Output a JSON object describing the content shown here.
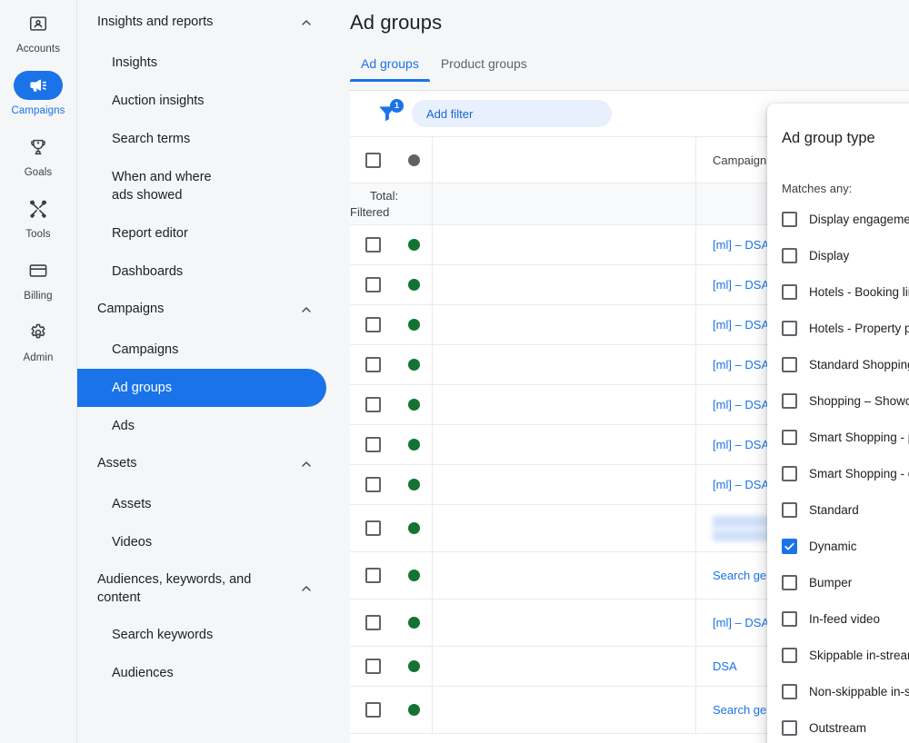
{
  "rail": {
    "items": [
      {
        "label": "Accounts",
        "icon": "accounts-icon",
        "active": false
      },
      {
        "label": "Campaigns",
        "icon": "campaigns-megaphone-icon",
        "active": true
      },
      {
        "label": "Goals",
        "icon": "goals-trophy-icon",
        "active": false
      },
      {
        "label": "Tools",
        "icon": "tools-wrench-icon",
        "active": false
      },
      {
        "label": "Billing",
        "icon": "billing-card-icon",
        "active": false
      },
      {
        "label": "Admin",
        "icon": "admin-gear-icon",
        "active": false
      }
    ]
  },
  "nav": {
    "groups": [
      {
        "title": "Insights and reports",
        "expanded": true,
        "items": [
          "Insights",
          "Auction insights",
          "Search terms",
          "When and where ads showed",
          "Report editor",
          "Dashboards"
        ]
      },
      {
        "title": "Campaigns",
        "expanded": true,
        "items": [
          "Campaigns",
          "Ad groups",
          "Ads"
        ]
      },
      {
        "title": "Assets",
        "expanded": true,
        "items": [
          "Assets",
          "Videos"
        ]
      },
      {
        "title": "Audiences, keywords, and content",
        "expanded": true,
        "items": [
          "Search keywords",
          "Audiences"
        ]
      }
    ],
    "selected": "Ad groups"
  },
  "header": {
    "title": "Ad groups",
    "tabs": [
      {
        "label": "Ad groups",
        "active": true
      },
      {
        "label": "Product groups",
        "active": false
      }
    ]
  },
  "toolbar": {
    "filter_badge_count": "1",
    "add_filter_label": "Add filter",
    "filter_icon": "filter-funnel-icon"
  },
  "table": {
    "columns": [
      "Campaign"
    ],
    "total_label": "Total: Filtered",
    "rows": [
      {
        "status": "green",
        "campaign": "[ml] – DSA – Joma",
        "redacted": false
      },
      {
        "status": "green",
        "campaign": "[ml] – DSA – Nike",
        "redacted": false
      },
      {
        "status": "green",
        "campaign": "[ml] – DSA – ",
        "redacted": true,
        "redacted_width": 78
      },
      {
        "status": "green",
        "campaign": "[ml] – DSA – Adidas",
        "redacted": false
      },
      {
        "status": "green",
        "campaign": "[ml] – DSA – ",
        "redacted": true,
        "redacted_width": 124
      },
      {
        "status": "green",
        "campaign": "[ml] – DSA – ",
        "redacted": true,
        "redacted_width": 53
      },
      {
        "status": "green",
        "campaign": "[ml] – DSA – ",
        "redacted": true,
        "redacted_width": 96
      },
      {
        "status": "green",
        "campaign": "",
        "redacted": true,
        "redacted_width": 124,
        "redacted_width2": 166
      },
      {
        "status": "green",
        "campaign": "Search generic FR",
        "redacted": false
      },
      {
        "status": "green",
        "campaign": "[ml] – DSA – I",
        "redacted": true,
        "redacted_width": 126
      },
      {
        "status": "green",
        "campaign": "DSA",
        "redacted": false
      },
      {
        "status": "green",
        "campaign": "Search generic EN",
        "redacted": false
      }
    ]
  },
  "dialog": {
    "title": "Ad group type",
    "close_icon": "close-x-icon",
    "matches_label": "Matches any:",
    "options": [
      {
        "label": "Display engagement",
        "checked": false
      },
      {
        "label": "Display",
        "checked": false
      },
      {
        "label": "Hotels - Booking link",
        "checked": false
      },
      {
        "label": "Hotels - Property promotion",
        "checked": false
      },
      {
        "label": "Standard Shopping - product",
        "checked": false
      },
      {
        "label": "Shopping – Showcase",
        "checked": false
      },
      {
        "label": "Smart Shopping - product",
        "checked": false
      },
      {
        "label": "Smart Shopping - collection",
        "checked": false
      },
      {
        "label": "Standard",
        "checked": false
      },
      {
        "label": "Dynamic",
        "checked": true
      },
      {
        "label": "Bumper",
        "checked": false
      },
      {
        "label": "In-feed video",
        "checked": false
      },
      {
        "label": "Skippable in-stream",
        "checked": false
      },
      {
        "label": "Non-skippable in-stream",
        "checked": false
      },
      {
        "label": "Outstream",
        "checked": false
      }
    ]
  },
  "colors": {
    "accent_blue": "#1a73e8",
    "link_blue": "#1a73e8",
    "status_green": "#137333",
    "status_grey": "#5f6368",
    "sidebar_bg": "#f5f6f7",
    "chip_bg": "#e8f0fe"
  }
}
